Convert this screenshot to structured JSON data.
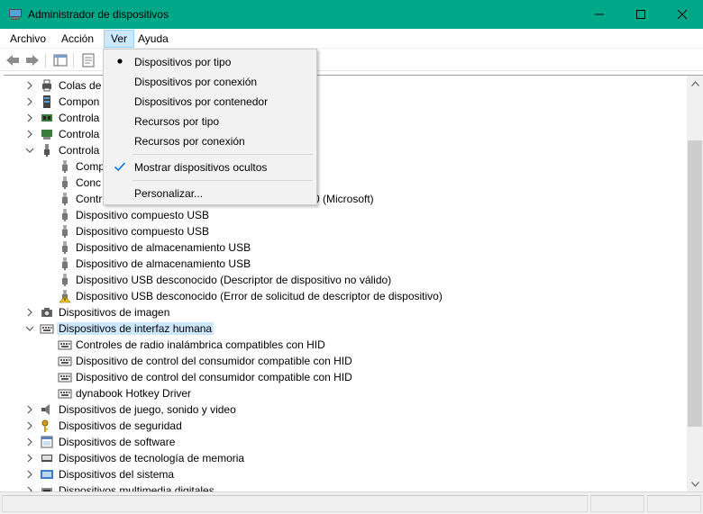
{
  "window": {
    "title": "Administrador de dispositivos",
    "accent": "#00a88a"
  },
  "menubar": {
    "items": [
      {
        "label": "Archivo"
      },
      {
        "label": "Acción"
      },
      {
        "label": "Ver"
      },
      {
        "label": "Ayuda"
      }
    ]
  },
  "view_menu": {
    "items": [
      {
        "label": "Dispositivos por tipo",
        "mark": "radio-dot"
      },
      {
        "label": "Dispositivos por conexión",
        "mark": ""
      },
      {
        "label": "Dispositivos por contenedor",
        "mark": ""
      },
      {
        "label": "Recursos por tipo",
        "mark": ""
      },
      {
        "label": "Recursos por conexión",
        "mark": ""
      },
      {
        "label": "Mostrar dispositivos ocultos",
        "mark": "checkmark"
      },
      {
        "label": "Personalizar...",
        "mark": ""
      }
    ]
  },
  "tree": {
    "rows": [
      {
        "label": "Colas de",
        "expander": "collapsed",
        "icon": "print-queue-icon"
      },
      {
        "label": "Compon",
        "expander": "collapsed",
        "icon": "software-component-icon"
      },
      {
        "label": "Controla",
        "expander": "collapsed",
        "icon": "controller-icon"
      },
      {
        "label": "Controla",
        "expander": "collapsed",
        "icon": "storage-controller-icon"
      },
      {
        "label": "Controla",
        "expander": "expanded",
        "icon": "usb-icon"
      },
      {
        "label": "Comp",
        "expander": "",
        "icon": "usb-plug-icon"
      },
      {
        "label": "Conc",
        "expander": "",
        "icon": "usb-plug-icon"
      },
      {
        "label": "Contr",
        "suffix": "0 (Microsoft)",
        "expander": "",
        "icon": "usb-plug-icon"
      },
      {
        "label": "Dispositivo compuesto USB",
        "expander": "",
        "icon": "usb-plug-icon"
      },
      {
        "label": "Dispositivo compuesto USB",
        "expander": "",
        "icon": "usb-plug-icon"
      },
      {
        "label": "Dispositivo de almacenamiento USB",
        "expander": "",
        "icon": "usb-plug-icon"
      },
      {
        "label": "Dispositivo de almacenamiento USB",
        "expander": "",
        "icon": "usb-plug-icon"
      },
      {
        "label": "Dispositivo USB desconocido (Descriptor de dispositivo no válido)",
        "expander": "",
        "icon": "usb-plug-icon"
      },
      {
        "label": "Dispositivo USB desconocido (Error de solicitud de descriptor de dispositivo)",
        "expander": "",
        "icon": "usb-warning-icon"
      },
      {
        "label": "Dispositivos de imagen",
        "expander": "collapsed",
        "icon": "camera-icon"
      },
      {
        "label": "Dispositivos de interfaz humana",
        "expander": "expanded",
        "icon": "keyboard-icon",
        "selected": true
      },
      {
        "label": "Controles de radio inalámbrica compatibles con HID",
        "expander": "",
        "icon": "keyboard-icon"
      },
      {
        "label": "Dispositivo de control del consumidor compatible con HID",
        "expander": "",
        "icon": "keyboard-icon"
      },
      {
        "label": "Dispositivo de control del consumidor compatible con HID",
        "expander": "",
        "icon": "keyboard-icon"
      },
      {
        "label": "dynabook Hotkey Driver",
        "expander": "",
        "icon": "keyboard-icon"
      },
      {
        "label": "Dispositivos de juego, sonido y video",
        "expander": "collapsed",
        "icon": "speaker-icon"
      },
      {
        "label": "Dispositivos de seguridad",
        "expander": "collapsed",
        "icon": "security-key-icon"
      },
      {
        "label": "Dispositivos de software",
        "expander": "collapsed",
        "icon": "software-device-icon"
      },
      {
        "label": "Dispositivos de tecnología de memoria",
        "expander": "collapsed",
        "icon": "memory-icon"
      },
      {
        "label": "Dispositivos del sistema",
        "expander": "collapsed",
        "icon": "system-folder-icon"
      },
      {
        "label": "Dispositivos multimedia digitales",
        "expander": "collapsed",
        "icon": "media-icon"
      }
    ]
  }
}
